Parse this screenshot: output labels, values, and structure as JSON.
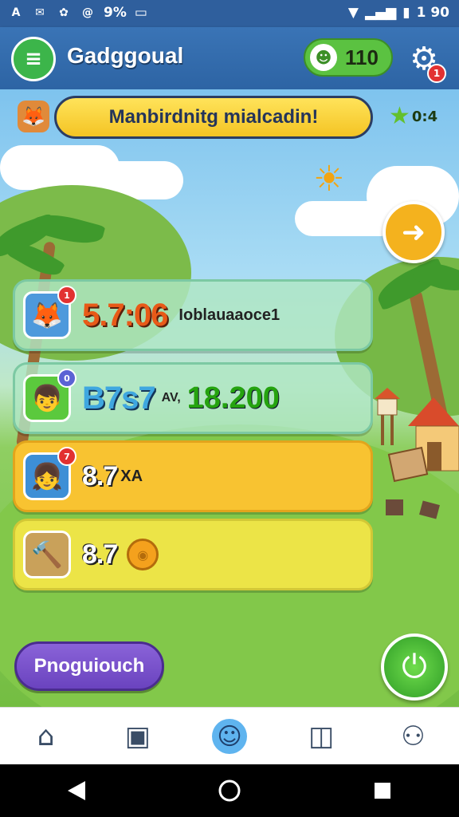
{
  "status_bar": {
    "left_icons": [
      "A",
      "✉",
      "✿",
      "@"
    ],
    "battery_percent_text": "9%",
    "clock": "1 90"
  },
  "header": {
    "title": "Gadggoual",
    "currency_value": "110",
    "settings_badge": "1"
  },
  "mission": {
    "banner_text": "Manbirdnitg mialcadin!",
    "timer": "0:4"
  },
  "cards": [
    {
      "avatar": "fox",
      "badge": "1",
      "value": "5.7:06",
      "subtext": "Ioblauaaoce1",
      "style": "green"
    },
    {
      "avatar": "boy",
      "badge": "0",
      "value": "B7s7",
      "subtext": "AV,",
      "value2": "18.200",
      "style": "green"
    },
    {
      "avatar": "girl",
      "badge": "7",
      "value": "8.7",
      "subtext": "XA",
      "style": "yellow"
    },
    {
      "avatar": "tools",
      "value": "8.7",
      "style": "lime"
    }
  ],
  "buttons": {
    "progress_label": "Pnoguiouch"
  },
  "bottom_nav": [
    "home",
    "storage",
    "profile-face",
    "camera",
    "user"
  ],
  "colors": {
    "header_blue": "#2f5f9d",
    "accent_green": "#3cb54a",
    "card_yellow": "#f8c331",
    "purple_button": "#6a43bf",
    "value_orange": "#e85a18",
    "value_blue": "#3fa7e0"
  }
}
